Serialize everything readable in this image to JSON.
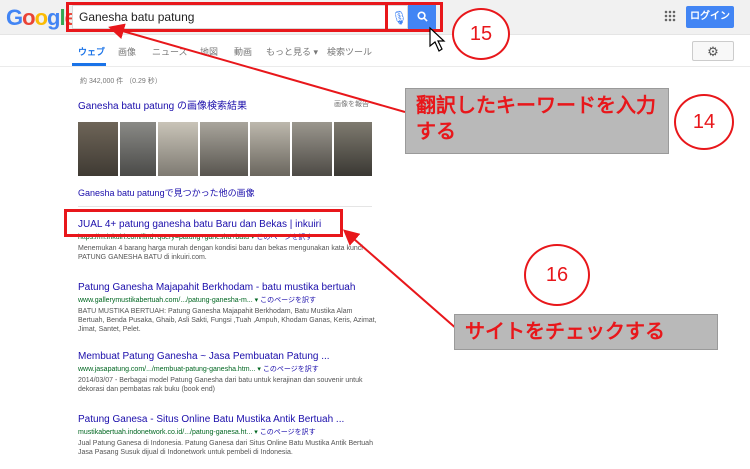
{
  "header": {
    "logo": "Google",
    "search_value": "Ganesha batu patung",
    "login_label": "ログイン"
  },
  "tabs": [
    "ウェブ",
    "画像",
    "ニュース",
    "地図",
    "動画",
    "もっと見る ▾",
    "検索ツール"
  ],
  "stats": "約 342,000 件 （0.29 秒）",
  "images": {
    "heading": "Ganesha batu patung の画像検索結果",
    "report": "画像を報告",
    "more": "Ganesha batu patungで見つかった他の画像"
  },
  "results": [
    {
      "title": "JUAL 4+ patung ganesha batu Baru dan Bekas | inkuiri",
      "url": "https://m.inkuiri.com/find?query=patung+ganesha+batu ▾",
      "translate": "このページを訳す",
      "snippet": "Menemukan 4 barang harga murah dengan kondisi baru dan bekas mengunakan kata kunci PATUNG GANESHA BATU di inkuiri.com."
    },
    {
      "title": "Patung Ganesha Majapahit Berkhodam - batu mustika bertuah",
      "url": "www.gallerymustikabertuah.com/.../patung-ganesha-m... ▾",
      "translate": "このページを訳す",
      "snippet": "BATU MUSTIKA BERTUAH: Patung Ganesha Majapahit Berkhodam, Batu Mustika Alam Bertuah, Benda Pusaka, Ghaib, Asli Sakti, Fungsi ,Tuah ,Ampuh, Khodam Ganas, Keris, Azimat, Jimat, Santet, Pelet."
    },
    {
      "title": "Membuat Patung Ganesha ~ Jasa Pembuatan Patung ...",
      "url": "www.jasapatung.com/.../membuat-patung-ganesha.htm... ▾",
      "translate": "このページを訳す",
      "snippet": "2014/03/07 - Berbagai model Patung Ganesha dari batu untuk kerajinan dan souvenir untuk dekorasi dan pembatas rak buku (book end)"
    },
    {
      "title": "Patung Ganesa - Situs Online Batu Mustika Antik Bertuah ...",
      "url": "mustikabertuah.indonetwork.co.id/.../patung-ganesa.ht... ▾",
      "translate": "このページを訳す",
      "snippet": "Jual Patung Ganesa di Indonesia. Patung Ganesa dari Situs Online Batu Mustika Antik Bertuah Jasa Pasang Susuk dijual di Indonetwork untuk pembeli di Indonesia."
    }
  ],
  "annotations": {
    "callout_14": "翻訳したキーワードを入力する",
    "callout_16": "サイトをチェックする",
    "n14": "14",
    "n15": "15",
    "n16": "16"
  },
  "icons": [
    "mic-icon",
    "search-icon",
    "apps-grid-icon",
    "gear-icon",
    "cursor-icon"
  ],
  "colors": {
    "annotation": "#e8171b",
    "link": "#1a0dab",
    "url": "#006621",
    "accent": "#4285f4"
  }
}
